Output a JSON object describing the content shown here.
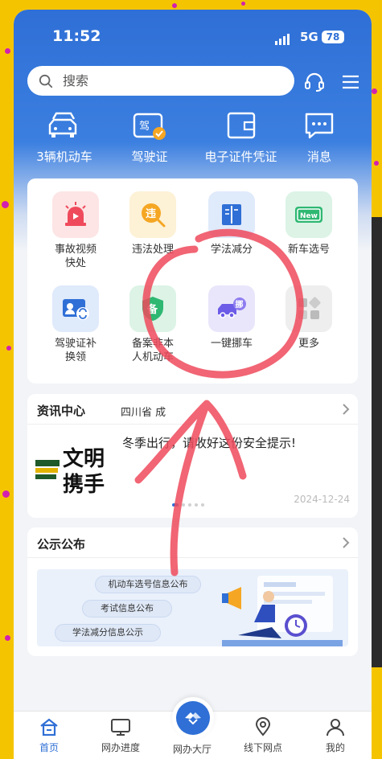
{
  "status_bar": {
    "time": "11:52",
    "network": "5G",
    "battery": "78"
  },
  "search": {
    "placeholder": "搜索"
  },
  "quick_actions": [
    {
      "label": "3辆机动车",
      "icon": "car-icon"
    },
    {
      "label": "驾驶证",
      "icon": "license-icon"
    },
    {
      "label": "电子证件凭证",
      "icon": "wallet-icon"
    },
    {
      "label": "消息",
      "icon": "message-icon"
    }
  ],
  "services": [
    {
      "label_1": "事故视频",
      "label_2": "快处",
      "icon": "siren-icon"
    },
    {
      "label_1": "违法处理",
      "label_2": "",
      "icon": "violation-icon",
      "glyph": "违"
    },
    {
      "label_1": "学法减分",
      "label_2": "",
      "icon": "book-icon"
    },
    {
      "label_1": "新车选号",
      "label_2": "",
      "icon": "new-plate-icon",
      "glyph": "New"
    },
    {
      "label_1": "驾驶证补",
      "label_2": "换领",
      "icon": "id-card-icon"
    },
    {
      "label_1": "备案非本",
      "label_2": "人机动车",
      "icon": "shield-icon",
      "glyph": "备"
    },
    {
      "label_1": "一键挪车",
      "label_2": "",
      "icon": "move-car-icon",
      "glyph": "挪"
    },
    {
      "label_1": "更多",
      "label_2": "",
      "icon": "more-icon"
    }
  ],
  "news": {
    "title": "资讯中心",
    "region": "四川省 成",
    "headline": "冬季出行，请收好这份安全提示!",
    "date": "2024-12-24",
    "thumb_text_1": "文明",
    "thumb_text_2": "携手"
  },
  "announcements": {
    "title": "公示公布",
    "items": [
      "机动车选号信息公布",
      "考试信息公布",
      "学法减分信息公示"
    ]
  },
  "nav": [
    {
      "label": "首页",
      "icon": "home-icon"
    },
    {
      "label": "网办进度",
      "icon": "monitor-icon"
    },
    {
      "label": "网办大厅",
      "icon": "handshake-icon"
    },
    {
      "label": "线下网点",
      "icon": "location-icon"
    },
    {
      "label": "我的",
      "icon": "user-icon"
    }
  ],
  "colors": {
    "primary": "#2f6fd6",
    "annotation": "#ef4a5c",
    "background": "#f5c400"
  }
}
